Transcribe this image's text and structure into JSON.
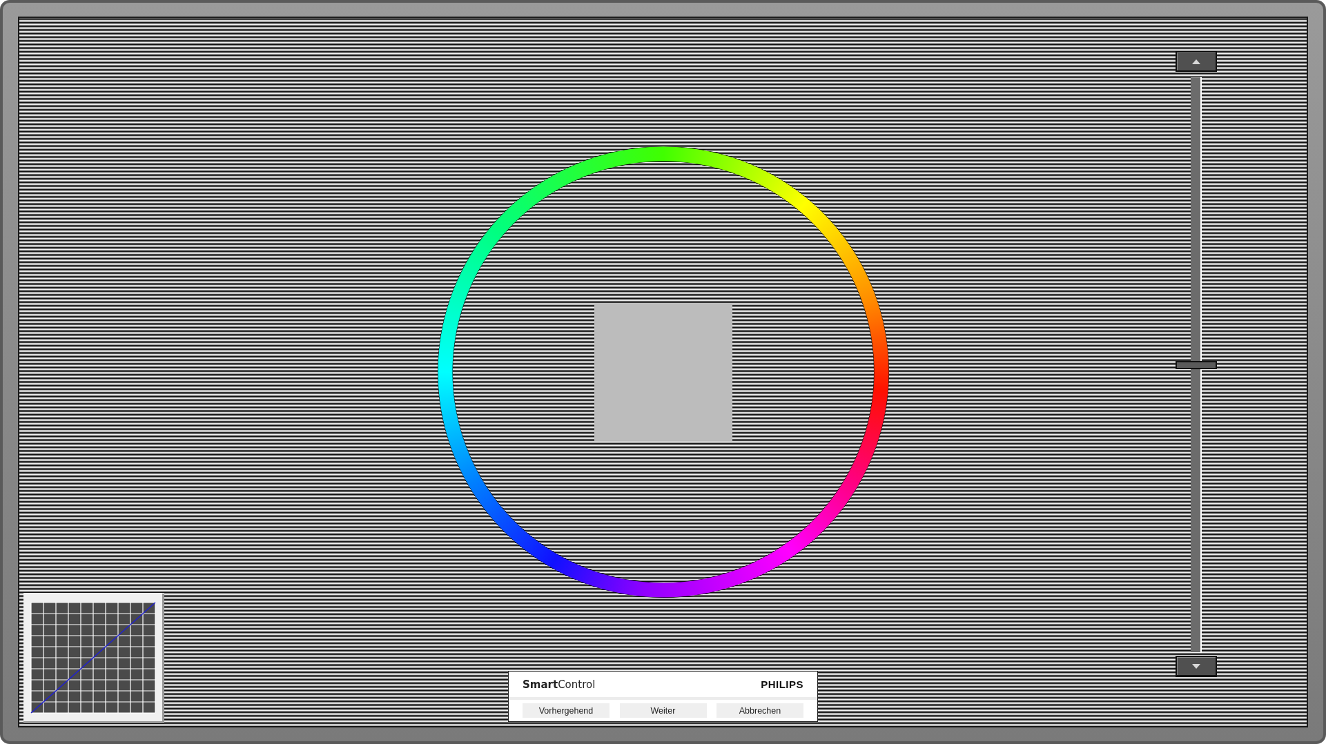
{
  "panel": {
    "brand": "**Smart**Control",
    "logo": "PHILIPS",
    "buttons": [
      "Vorhergehend",
      "Weiter",
      "Abbrechen"
    ]
  },
  "slider": {
    "level": 0.5
  }
}
